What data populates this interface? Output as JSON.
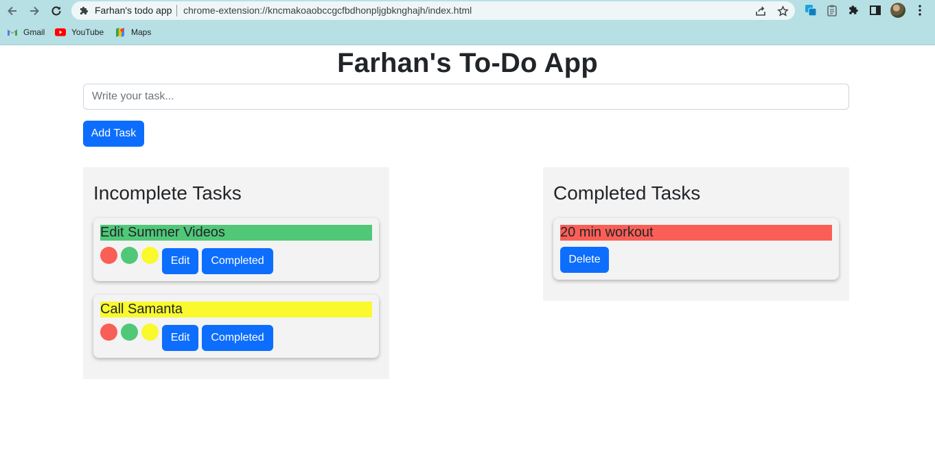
{
  "browser": {
    "tab_title": "Farhan's todo app",
    "url": "chrome-extension://kncmakoaobccgcfbdhonpljgbknghajh/index.html",
    "bookmarks": [
      {
        "label": "Gmail",
        "icon": "gmail-icon"
      },
      {
        "label": "YouTube",
        "icon": "youtube-icon"
      },
      {
        "label": "Maps",
        "icon": "maps-icon"
      }
    ]
  },
  "app": {
    "title": "Farhan's To-Do App",
    "input_placeholder": "Write your task...",
    "input_value": "",
    "add_button": "Add Task"
  },
  "colors": {
    "primary": "#0d6efd",
    "red": "#f95f56",
    "green": "#50c878",
    "yellow": "#f9f92d",
    "panel_bg": "#f3f3f3"
  },
  "incomplete": {
    "heading": "Incomplete Tasks",
    "tasks": [
      {
        "text": "Edit Summer Videos",
        "highlight": "green",
        "edit_label": "Edit",
        "complete_label": "Completed"
      },
      {
        "text": "Call Samanta",
        "highlight": "yellow",
        "edit_label": "Edit",
        "complete_label": "Completed"
      }
    ]
  },
  "completed": {
    "heading": "Completed Tasks",
    "tasks": [
      {
        "text": "20 min workout",
        "highlight": "red",
        "delete_label": "Delete"
      }
    ]
  }
}
